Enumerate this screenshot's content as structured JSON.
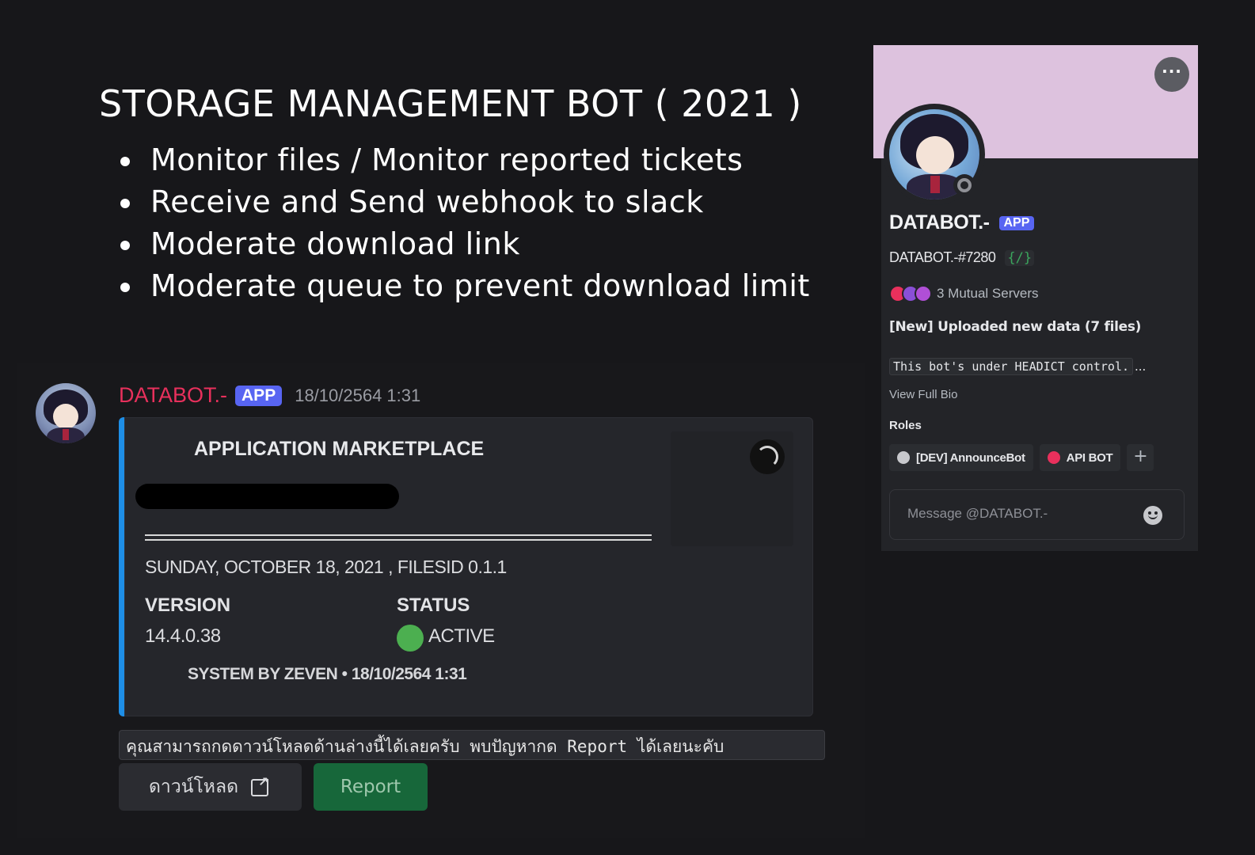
{
  "slide": {
    "title": "STORAGE MANAGEMENT BOT ( 2021 )",
    "bullets": [
      "Monitor files / Monitor reported tickets",
      "Receive and Send webhook to slack",
      "Moderate download link",
      "Moderate queue to prevent download limit"
    ]
  },
  "message": {
    "author": "DATABOT.-",
    "app_tag": "APP",
    "timestamp": "18/10/2564 1:31",
    "embed": {
      "title": "APPLICATION MARKETPLACE",
      "date_line": "SUNDAY, OCTOBER 18, 2021 , FILESID 0.1.1",
      "version_label": "VERSION",
      "version_value": "14.4.0.38",
      "status_label": "STATUS",
      "status_value": "ACTIVE",
      "footer": "SYSTEM BY ZEVEN • 18/10/2564 1:31",
      "accent_color": "#1e8ee6",
      "status_color": "#4caf50"
    },
    "code_text": "คุณสามารถกดดาวน์โหลดด้านล่างนี้ได้เลยครับ พบปัญหากด Report ได้เลยนะคับ",
    "buttons": {
      "download_label": "ดาวน์โหลด",
      "report_label": "Report"
    }
  },
  "profile": {
    "more_label": "···",
    "name": "DATABOT.-",
    "app_tag": "APP",
    "tag": "DATABOT.-#7280",
    "slash_badge": "{/}",
    "mutual_servers": "3 Mutual Servers",
    "status_text": "[New] Uploaded new data (7 files)",
    "bio": "This bot's under HEADICT control.",
    "bio_ellipsis": "...",
    "view_full_bio": "View Full Bio",
    "roles_title": "Roles",
    "roles": [
      {
        "name": "[DEV] AnnounceBot",
        "color": "#c7c8cc"
      },
      {
        "name": "API BOT",
        "color": "#e8305c"
      }
    ],
    "add_role": "+",
    "message_placeholder": "Message @DATABOT.-",
    "banner_color": "#ddc2de"
  }
}
